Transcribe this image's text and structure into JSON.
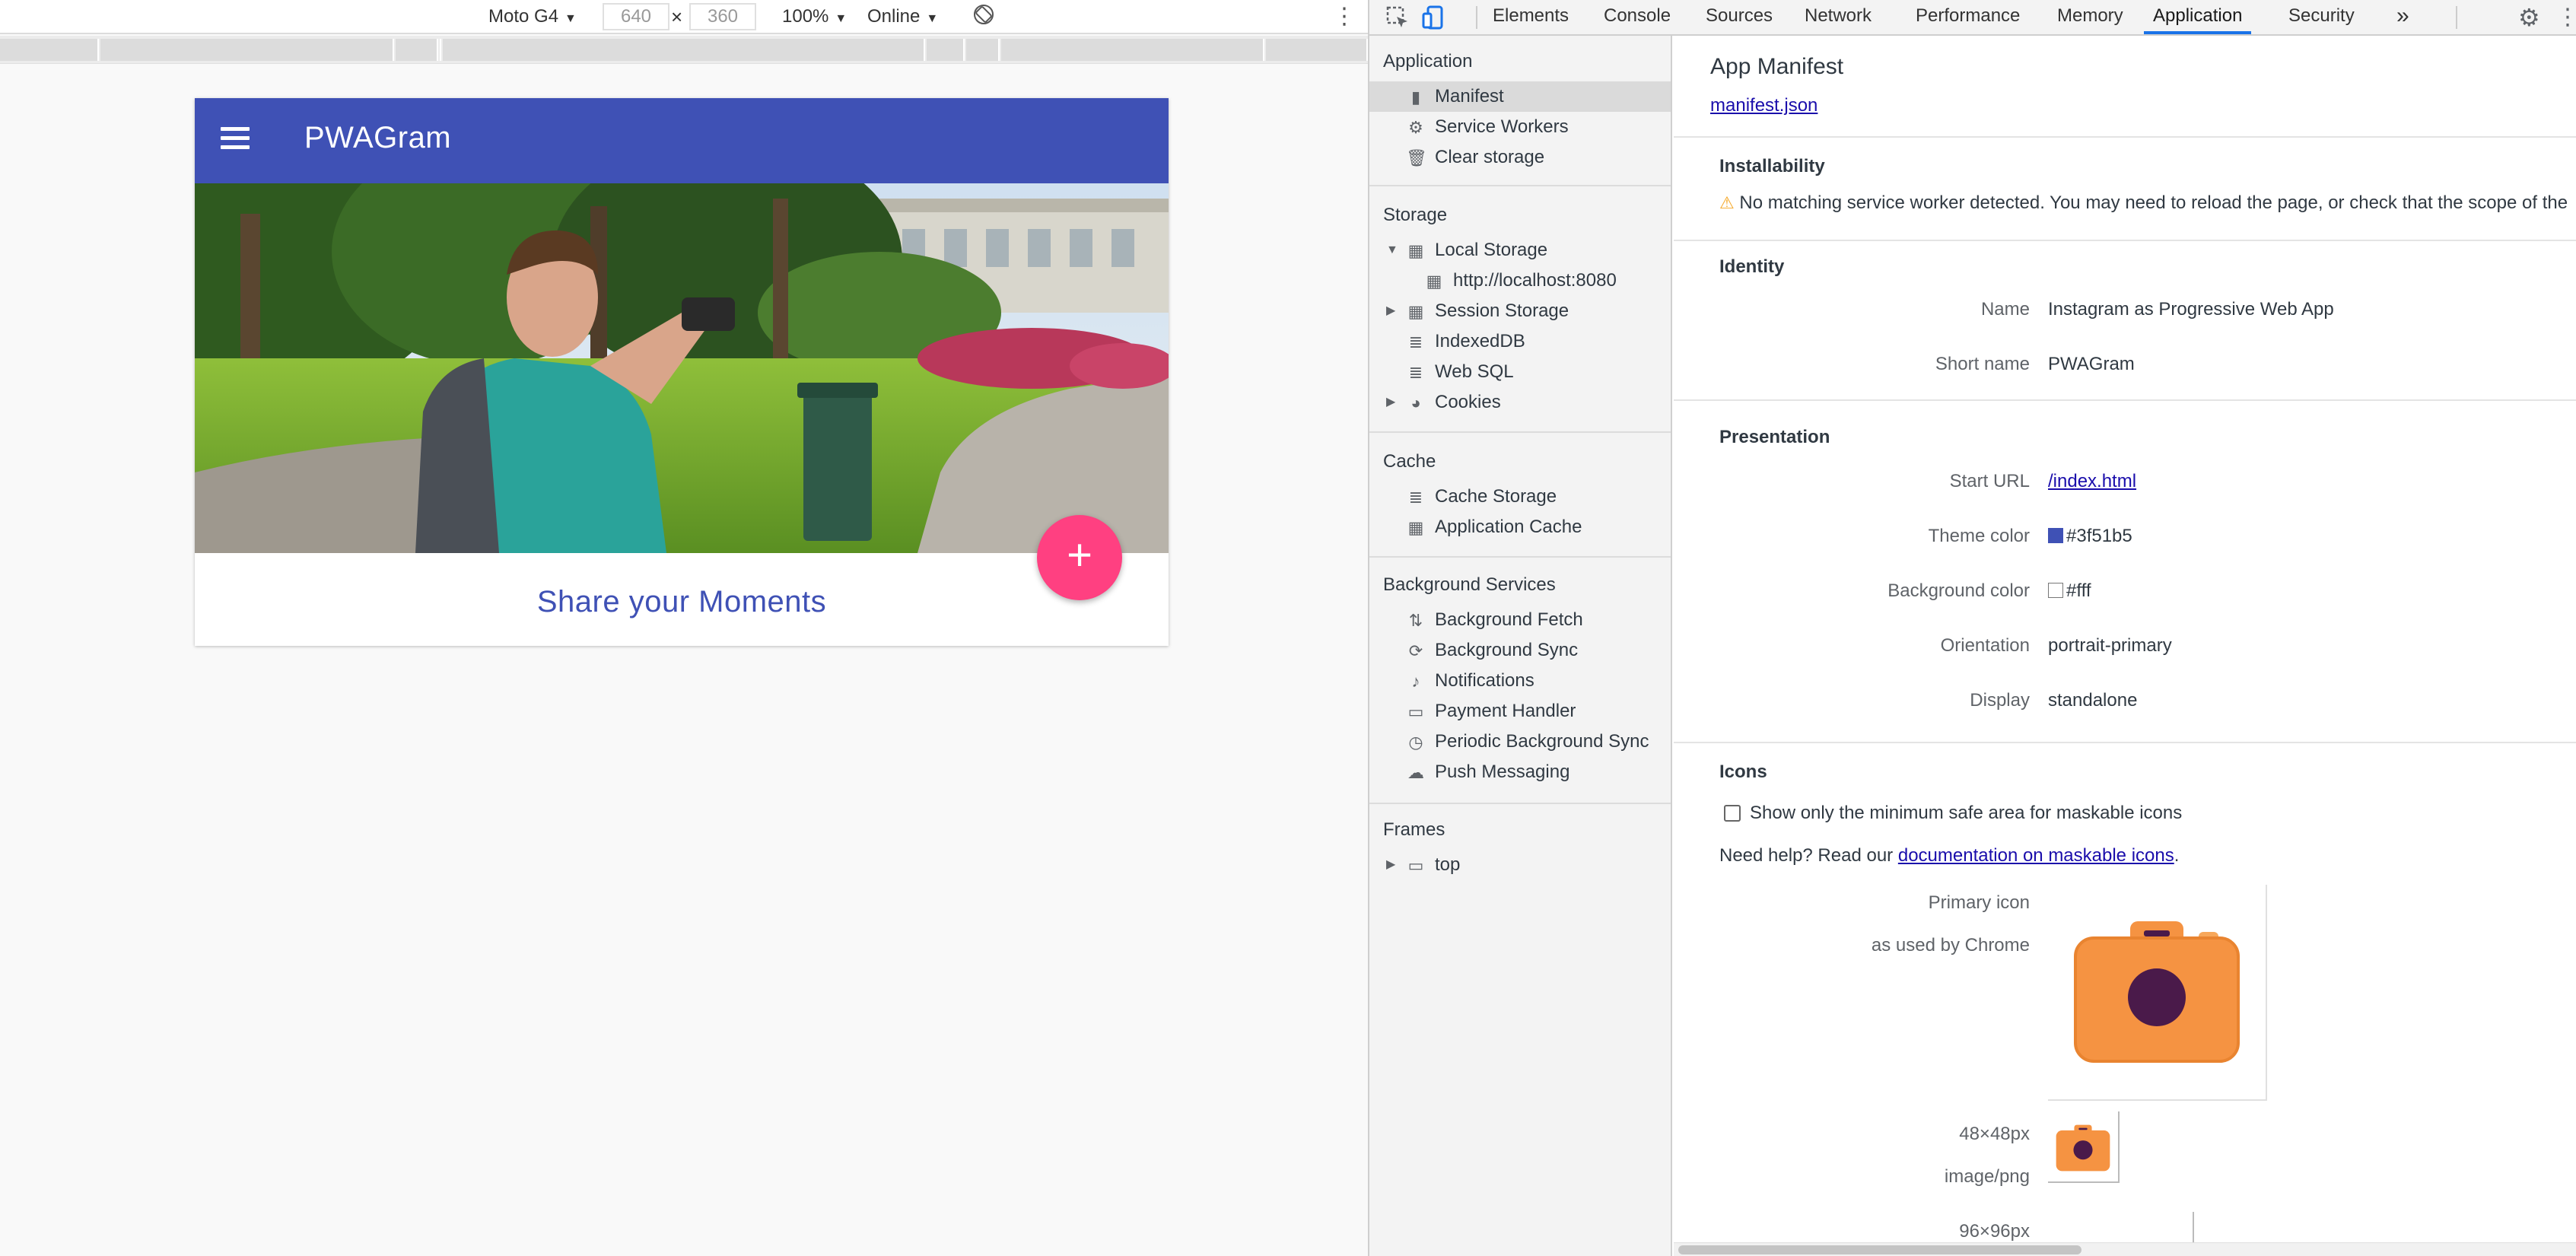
{
  "device_toolbar": {
    "device": "Moto G4",
    "width": "640",
    "times": "×",
    "height": "360",
    "zoom": "100%",
    "throttle": "Online"
  },
  "app": {
    "title": "PWAGram",
    "share_text": "Share your Moments",
    "fab_label": "+"
  },
  "devtools": {
    "tabs": [
      "Elements",
      "Console",
      "Sources",
      "Network",
      "Performance",
      "Memory",
      "Application",
      "Security"
    ],
    "more_tabs": "»",
    "active_tab": "Application"
  },
  "sidebar": {
    "sections": {
      "application": "Application",
      "storage": "Storage",
      "cache": "Cache",
      "background_services": "Background Services",
      "frames": "Frames"
    },
    "items": {
      "manifest": "Manifest",
      "service_workers": "Service Workers",
      "clear_storage": "Clear storage",
      "local_storage": "Local Storage",
      "localhost": "http://localhost:8080",
      "session_storage": "Session Storage",
      "indexeddb": "IndexedDB",
      "web_sql": "Web SQL",
      "cookies": "Cookies",
      "cache_storage": "Cache Storage",
      "application_cache": "Application Cache",
      "background_fetch": "Background Fetch",
      "background_sync": "Background Sync",
      "notifications": "Notifications",
      "payment_handler": "Payment Handler",
      "periodic_background_sync": "Periodic Background Sync",
      "push_messaging": "Push Messaging",
      "top": "top"
    }
  },
  "manifest": {
    "title": "App Manifest",
    "link": "manifest.json",
    "installability": {
      "heading": "Installability",
      "warning": "No matching service worker detected. You may need to reload the page, or check that the scope of the"
    },
    "identity": {
      "heading": "Identity",
      "name_label": "Name",
      "name": "Instagram as Progressive Web App",
      "short_name_label": "Short name",
      "short_name": "PWAGram"
    },
    "presentation": {
      "heading": "Presentation",
      "start_url_label": "Start URL",
      "start_url": "/index.html",
      "theme_color_label": "Theme color",
      "theme_color": "#3f51b5",
      "background_color_label": "Background color",
      "background_color": "#fff",
      "orientation_label": "Orientation",
      "orientation": "portrait-primary",
      "display_label": "Display",
      "display": "standalone"
    },
    "icons": {
      "heading": "Icons",
      "checkbox_label": "Show only the minimum safe area for maskable icons",
      "help_prefix": "Need help? Read our ",
      "help_link": "documentation on maskable icons",
      "help_suffix": ".",
      "primary_label": "Primary icon",
      "primary_sub": "as used by Chrome",
      "icon1_size": "48×48px",
      "icon1_type": "image/png",
      "icon2_size": "96×96px"
    }
  },
  "colors": {
    "app_bar": "#3f51b5",
    "fab": "#ff4081",
    "icon_orange": "#f59342",
    "icon_lens": "#4a1a4a",
    "active_tab_underline": "#1a73e8"
  }
}
